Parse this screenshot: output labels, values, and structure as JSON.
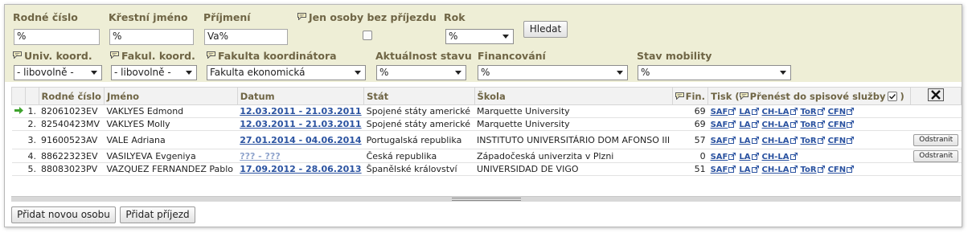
{
  "filters": {
    "rodne_cislo": {
      "label": "Rodné číslo",
      "value": "%"
    },
    "krestni_jmeno": {
      "label": "Křestní jméno",
      "value": "%"
    },
    "prijmeni": {
      "label": "Příjmení",
      "value": "Va%"
    },
    "bez_prijezdu": {
      "label": "Jen osoby bez příjezdu"
    },
    "rok": {
      "label": "Rok",
      "value": "%"
    },
    "hledat": "Hledat",
    "univ_koord": {
      "label": "Univ. koord.",
      "value": "- libovolně -"
    },
    "fakul_koord": {
      "label": "Fakul. koord.",
      "value": "- libovolně -"
    },
    "fakulta_koord": {
      "label": "Fakulta koordinátora",
      "value": "Fakulta ekonomická"
    },
    "aktualnost": {
      "label": "Aktuálnost stavu",
      "value": "%"
    },
    "financovani": {
      "label": "Financování",
      "value": "%"
    },
    "stav_mobility": {
      "label": "Stav mobility",
      "value": "%"
    }
  },
  "table": {
    "headers": {
      "rc": "Rodné číslo",
      "jmeno": "Jméno",
      "datum": "Datum",
      "stat": "Stát",
      "skola": "Škola",
      "fin": "Fin.",
      "tisk_prefix": "Tisk (",
      "tisk_label": "Přenést do spisové služby",
      "tisk_suffix": ")"
    },
    "rows": [
      {
        "n": "1.",
        "rc": "82061023EV",
        "jmeno": "VAKLYES Edmond",
        "datum": "12.03.2011 - 21.03.2011",
        "stat": "Spojené státy americké",
        "skola": "Marquette University",
        "fin": "69",
        "remove": ""
      },
      {
        "n": "2.",
        "rc": "82540423MV",
        "jmeno": "VAKLYES Molly",
        "datum": "12.03.2011 - 21.03.2011",
        "stat": "Spojené státy americké",
        "skola": "Marquette University",
        "fin": "69",
        "remove": ""
      },
      {
        "n": "3.",
        "rc": "91600523AV",
        "jmeno": "VALE Adriana",
        "datum": "27.01.2014 - 04.06.2014",
        "stat": "Portugalská republika",
        "skola": "INSTITUTO UNIVERSITÁRIO DOM AFONSO III",
        "fin": "57",
        "remove": "Odstranit"
      },
      {
        "n": "4.",
        "rc": "88622323EV",
        "jmeno": "VASILYEVA Evgeniya",
        "datum": "??? - ???",
        "stat": "Česká republika",
        "skola": "Západočeská univerzita v Plzni",
        "fin": "0",
        "remove": "Odstranit"
      },
      {
        "n": "5.",
        "rc": "88083023PV",
        "jmeno": "VAZQUEZ FERNANDEZ Pablo",
        "datum": "17.09.2012 - 28.06.2013",
        "stat": "Španělské království",
        "skola": "UNIVERSIDAD DE VIGO",
        "fin": "51",
        "remove": ""
      }
    ],
    "links": {
      "saf": "SAF",
      "la": "LA",
      "chla": "CH-LA",
      "tor": "ToR",
      "cfn": "CFN"
    }
  },
  "buttons": {
    "add_person": "Přidat novou osobu",
    "add_arrival": "Přidat příjezd"
  },
  "icons": {
    "comment": "speech-bubble-icon",
    "excel": "excel-export-icon",
    "current_row": "green-arrow-icon",
    "external": "external-link-icon"
  },
  "colors": {
    "filter_bg": "#eeeed6",
    "label": "#6f6545",
    "link": "#2a52a0"
  }
}
